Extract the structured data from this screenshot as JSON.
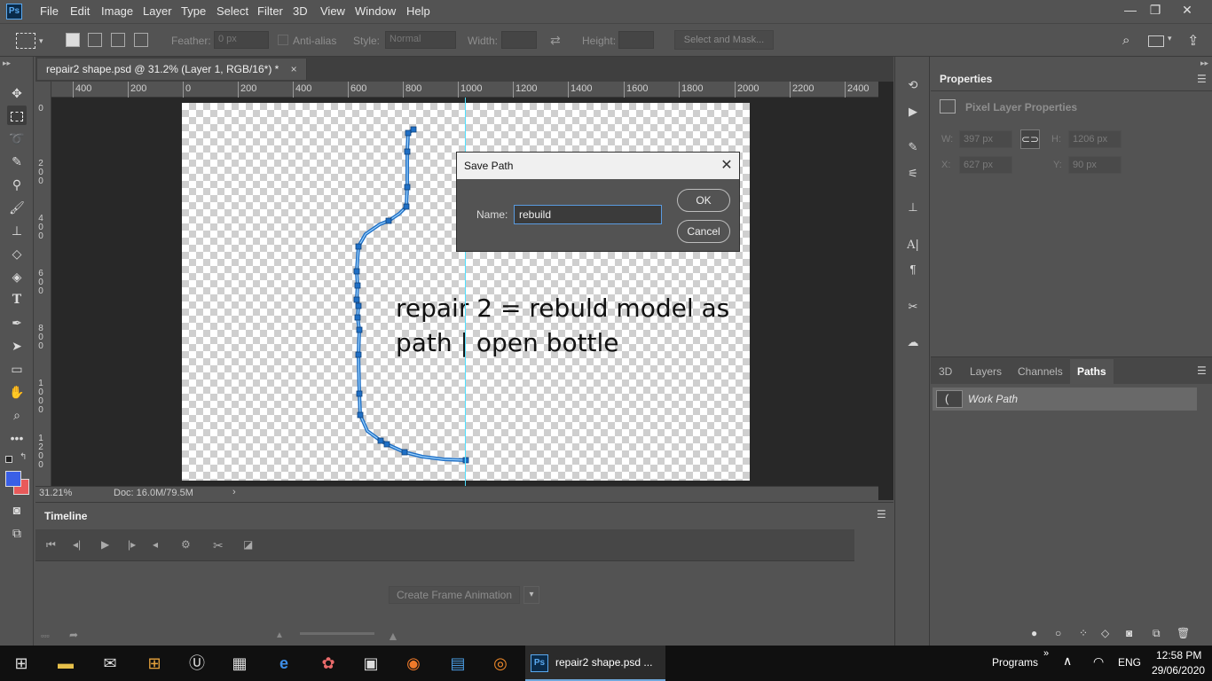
{
  "app": {
    "name": "Photoshop",
    "logo": "Ps"
  },
  "menu": [
    "File",
    "Edit",
    "Image",
    "Layer",
    "Type",
    "Select",
    "Filter",
    "3D",
    "View",
    "Window",
    "Help"
  ],
  "window_controls": {
    "minimize": "—",
    "restore": "❐",
    "close": "✕"
  },
  "options": {
    "feather_label": "Feather:",
    "feather_value": "0 px",
    "antialias_label": "Anti-alias",
    "style_label": "Style:",
    "style_value": "Normal",
    "width_label": "Width:",
    "height_label": "Height:",
    "select_mask": "Select and Mask..."
  },
  "document": {
    "tab_title": "repair2 shape.psd @ 31.2% (Layer 1, RGB/16*) *",
    "tab_close": "×",
    "canvas_text": "repair 2 = rebuld model as path | open bottle"
  },
  "ruler": {
    "h": [
      "400",
      "200",
      "0",
      "200",
      "400",
      "600",
      "800",
      "1000",
      "1200",
      "1400",
      "1600",
      "1800",
      "2000",
      "2200",
      "2400"
    ],
    "v": [
      "0",
      "2\n0\n0",
      "4\n0\n0",
      "6\n0\n0",
      "8\n0\n0",
      "1\n0\n0\n0",
      "1\n2\n0\n0"
    ]
  },
  "status": {
    "zoom": "31.21%",
    "doc": "Doc: 16.0M/79.5M",
    "arrow": "›"
  },
  "timeline": {
    "tab": "Timeline",
    "create_frame": "Create Frame Animation"
  },
  "properties": {
    "tab": "Properties",
    "subtitle": "Pixel Layer Properties",
    "w_label": "W:",
    "w_value": "397 px",
    "h_label": "H:",
    "h_value": "1206 px",
    "x_label": "X:",
    "x_value": "627 px",
    "y_label": "Y:",
    "y_value": "90 px"
  },
  "paths_panel": {
    "tabs": [
      "3D",
      "Layers",
      "Channels",
      "Paths"
    ],
    "active_tab": "Paths",
    "items": [
      {
        "name": "Work Path"
      }
    ]
  },
  "dialog": {
    "title": "Save Path",
    "name_label": "Name:",
    "name_value": "rebuild",
    "ok": "OK",
    "cancel": "Cancel"
  },
  "taskbar": {
    "active_app": "repair2 shape.psd ...",
    "programs": "Programs",
    "lang": "ENG",
    "time": "12:58 PM",
    "date": "29/06/2020"
  },
  "colors": {
    "foreground": "#3a5fe6",
    "background": "#e85a5a",
    "path_stroke": "#1f6fc5",
    "guide": "#4ee0ff"
  }
}
